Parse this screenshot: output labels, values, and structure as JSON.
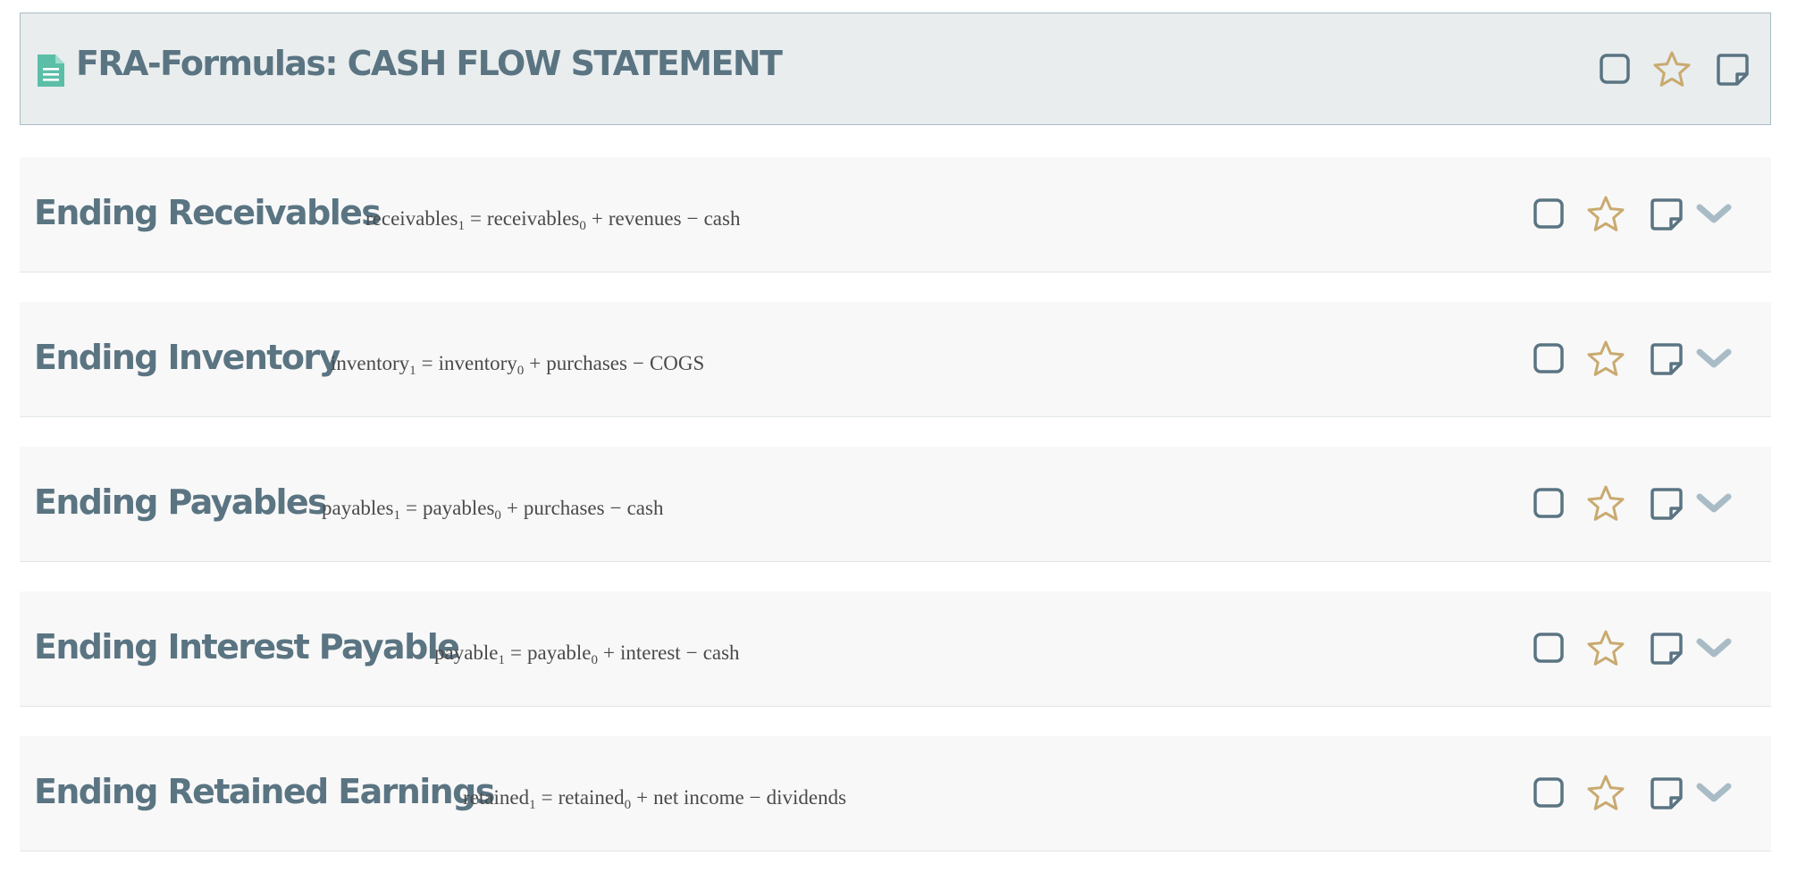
{
  "header": {
    "title": "FRA-Formulas: CASH FLOW STATEMENT",
    "icons": [
      "document-icon",
      "checkbox-icon",
      "star-icon",
      "note-icon"
    ]
  },
  "colors": {
    "title": "#5a7482",
    "doc_icon": "#5bbfa8",
    "star": "#c9aa6f",
    "outline_icon": "#5a7482",
    "chevron": "#a9bcc6",
    "header_bg": "#e9edee",
    "row_bg": "#f8f8f8"
  },
  "rows": [
    {
      "title": "Ending Receivables",
      "formula": {
        "lhs": "receivables",
        "lhs_sub": "1",
        "eq": "=",
        "rhs": "receivables",
        "rhs_sub": "0",
        "plus": "+",
        "term1": "revenues",
        "minus": "−",
        "term2": "cash"
      }
    },
    {
      "title": "Ending Inventory",
      "formula": {
        "lhs": "inventory",
        "lhs_sub": "1",
        "eq": "=",
        "rhs": "inventory",
        "rhs_sub": "0",
        "plus": "+",
        "term1": "purchases",
        "minus": "−",
        "term2": "COGS"
      }
    },
    {
      "title": "Ending Payables",
      "formula": {
        "lhs": "payables",
        "lhs_sub": "1",
        "eq": "=",
        "rhs": "payables",
        "rhs_sub": "0",
        "plus": "+",
        "term1": "purchases",
        "minus": "−",
        "term2": "cash"
      }
    },
    {
      "title": "Ending Interest Payable",
      "formula": {
        "lhs": "payable",
        "lhs_sub": "1",
        "eq": "=",
        "rhs": "payable",
        "rhs_sub": "0",
        "plus": "+",
        "term1": "interest",
        "minus": "−",
        "term2": "cash"
      }
    },
    {
      "title": "Ending Retained Earnings",
      "formula": {
        "lhs": "retained",
        "lhs_sub": "1",
        "eq": "=",
        "rhs": "retained",
        "rhs_sub": "0",
        "plus": "+",
        "term1": "net income",
        "minus": "−",
        "term2": "dividends"
      }
    }
  ]
}
